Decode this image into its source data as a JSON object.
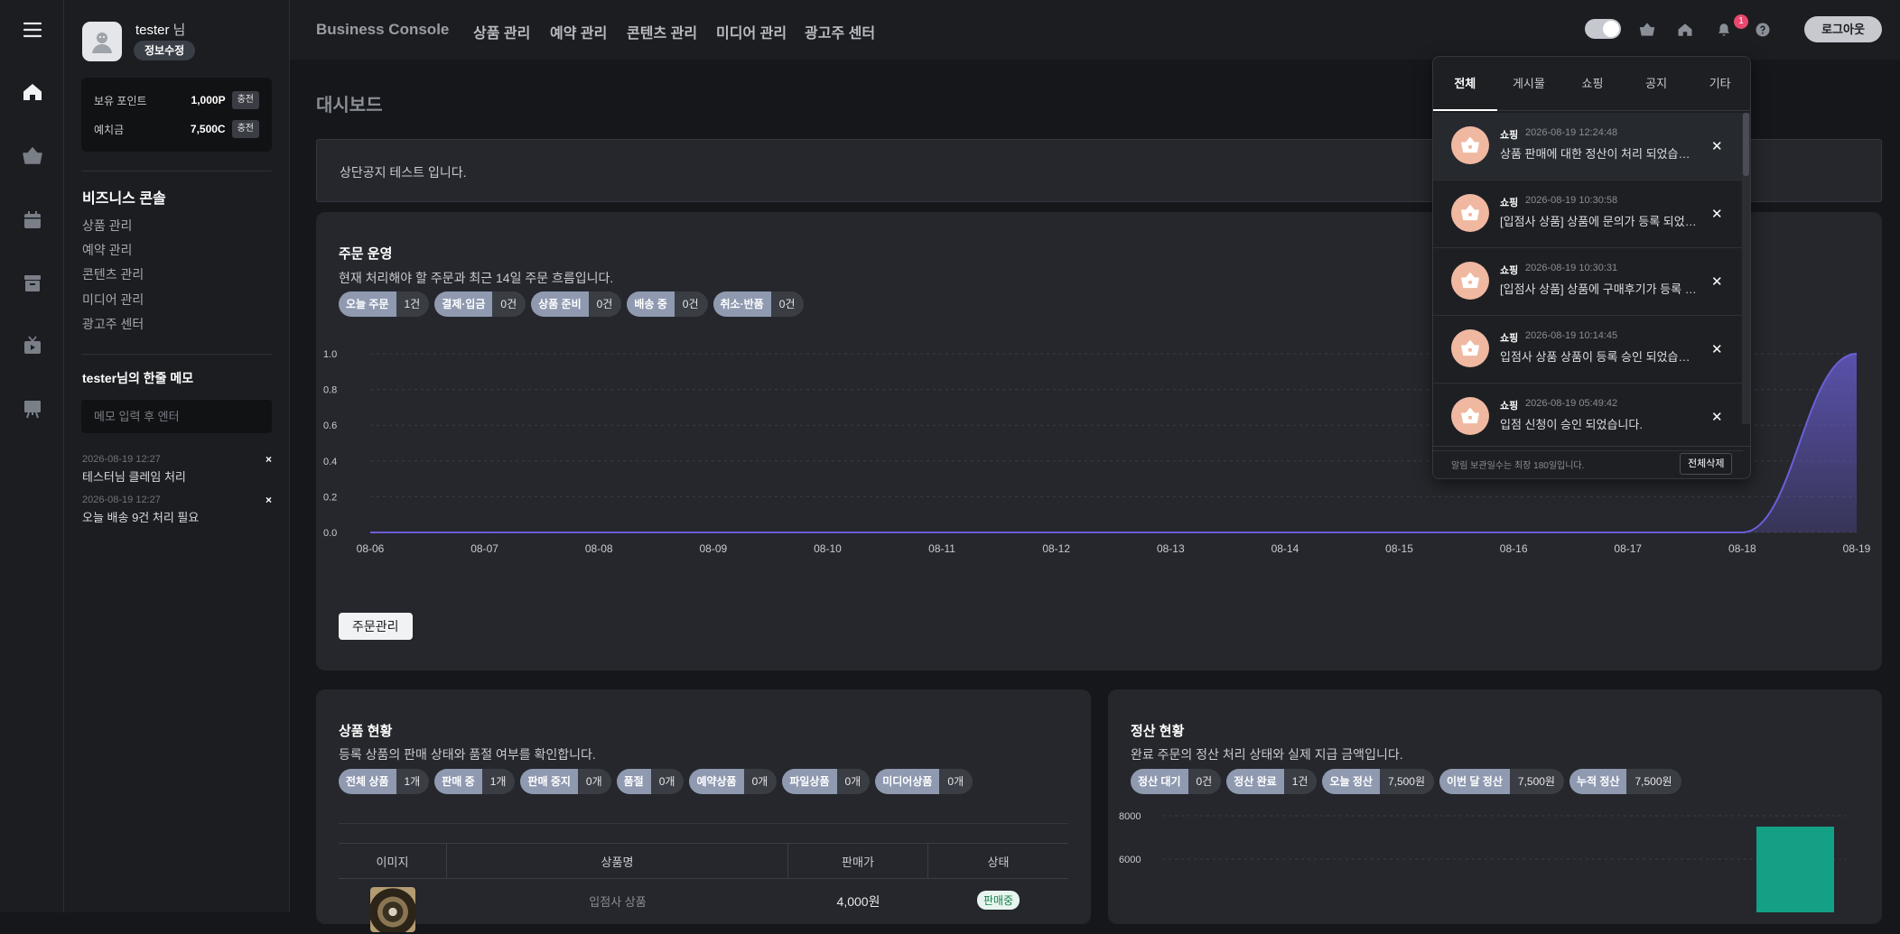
{
  "header": {
    "brand": "Business Console",
    "nav": [
      "상품 관리",
      "예약 관리",
      "콘텐츠 관리",
      "미디어 관리",
      "광고주 센터"
    ],
    "notification_count": "1",
    "logout": "로그아웃"
  },
  "profile": {
    "name": "tester",
    "suffix": "님",
    "edit": "정보수정",
    "points_label": "보유 포인트",
    "points_value": "1,000P",
    "deposit_label": "예치금",
    "deposit_value": "7,500C",
    "charge": "충전"
  },
  "side": {
    "title": "비즈니스 콘솔",
    "menu": [
      "상품 관리",
      "예약 관리",
      "콘텐츠 관리",
      "미디어 관리",
      "광고주 센터"
    ],
    "memo_title": "tester님의 한줄 메모",
    "memo_placeholder": "메모 입력 후 엔터",
    "memos": [
      {
        "date": "2026-08-19 12:27",
        "text": "테스터님 클레임 처리"
      },
      {
        "date": "2026-08-19 12:27",
        "text": "오늘 배송 9건 처리 필요"
      }
    ],
    "memo_delete": "×"
  },
  "main": {
    "title": "대시보드",
    "notice": "상단공지 테스트 입니다."
  },
  "orders": {
    "title": "주문 운영",
    "desc": "현재 처리해야 할 주문과 최근 14일 주문 흐름입니다.",
    "chips": [
      {
        "k": "오늘 주문",
        "v": "1건"
      },
      {
        "k": "결제·입금",
        "v": "0건"
      },
      {
        "k": "상품 준비",
        "v": "0건"
      },
      {
        "k": "배송 중",
        "v": "0건"
      },
      {
        "k": "취소·반품",
        "v": "0건"
      }
    ],
    "button": "주문관리"
  },
  "products": {
    "title": "상품 현황",
    "desc": "등록 상품의 판매 상태와 품절 여부를 확인합니다.",
    "chips": [
      {
        "k": "전체 상품",
        "v": "1개"
      },
      {
        "k": "판매 중",
        "v": "1개"
      },
      {
        "k": "판매 중지",
        "v": "0개"
      },
      {
        "k": "품절",
        "v": "0개"
      },
      {
        "k": "예약상품",
        "v": "0개"
      },
      {
        "k": "파일상품",
        "v": "0개"
      },
      {
        "k": "미디어상품",
        "v": "0개"
      }
    ],
    "columns": [
      "이미지",
      "상품명",
      "판매가",
      "상태"
    ],
    "row": {
      "name": "입점사 상품",
      "price": "4,000원",
      "status": "판매중"
    }
  },
  "settlement": {
    "title": "정산 현황",
    "desc": "완료 주문의 정산 처리 상태와 실제 지급 금액입니다.",
    "chips": [
      {
        "k": "정산 대기",
        "v": "0건"
      },
      {
        "k": "정산 완료",
        "v": "1건"
      },
      {
        "k": "오늘 정산",
        "v": "7,500원"
      },
      {
        "k": "이번 달 정산",
        "v": "7,500원"
      },
      {
        "k": "누적 정산",
        "v": "7,500원"
      }
    ]
  },
  "notifications": {
    "tabs": [
      "전체",
      "게시물",
      "쇼핑",
      "공지",
      "기타"
    ],
    "items": [
      {
        "cat": "쇼핑",
        "date": "2026-08-19 12:24:48",
        "text": "상품 판매에 대한 정산이 처리 되었습니다."
      },
      {
        "cat": "쇼핑",
        "date": "2026-08-19 10:30:58",
        "text": "[입점사 상품] 상품에 문의가 등록 되었습니다."
      },
      {
        "cat": "쇼핑",
        "date": "2026-08-19 10:30:31",
        "text": "[입점사 상품] 상품에 구매후기가 등록 되었습니다."
      },
      {
        "cat": "쇼핑",
        "date": "2026-08-19 10:14:45",
        "text": "입점사 상품 상품이 등록 승인 되었습니다."
      },
      {
        "cat": "쇼핑",
        "date": "2026-08-19 05:49:42",
        "text": "입점 신청이 승인 되었습니다."
      }
    ],
    "close": "✕",
    "footer": "알림 보관일수는 최장 180일입니다.",
    "clear_all": "전체삭제"
  },
  "chart_data": [
    {
      "type": "area",
      "x": [
        "08-06",
        "08-07",
        "08-08",
        "08-09",
        "08-10",
        "08-11",
        "08-12",
        "08-13",
        "08-14",
        "08-15",
        "08-16",
        "08-17",
        "08-18",
        "08-19"
      ],
      "values": [
        0,
        0,
        0,
        0,
        0,
        0,
        0,
        0,
        0,
        0,
        0,
        0,
        0,
        1
      ],
      "ylim": [
        0,
        1.0
      ],
      "yticks": [
        "1.0",
        "0.8",
        "0.6",
        "0.4",
        "0.2",
        "0.0"
      ],
      "grid": true,
      "color": "#6b5fd6"
    },
    {
      "type": "bar",
      "yticks": [
        "8000",
        "6000"
      ],
      "values": [
        7500
      ],
      "color": "#13a085"
    }
  ]
}
